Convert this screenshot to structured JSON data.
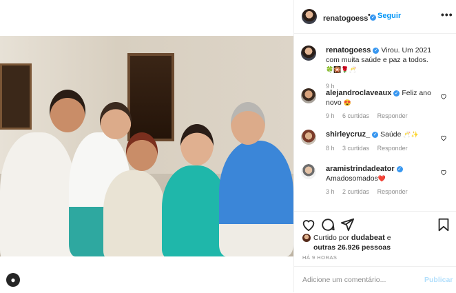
{
  "post": {
    "author": "renatogoess",
    "follow_label": "Seguir",
    "separator": "•",
    "more_label": "•••",
    "verified_mark": "✓"
  },
  "comments": [
    {
      "user": "renatogoess",
      "verified": true,
      "text": "Virou. Um 2021 com muita saúde e paz a todos.",
      "emojis": "🍀🎇🌹🥂",
      "time": "9 h",
      "likes": "",
      "reply": ""
    },
    {
      "user": "alejandroclaveaux",
      "verified": true,
      "text": "Feliz ano novo",
      "emojis": "😍",
      "time": "9 h",
      "likes": "6 curtidas",
      "reply": "Responder"
    },
    {
      "user": "shirleycruz_",
      "verified": true,
      "text": "Saúde",
      "emojis": "🥂✨",
      "time": "8 h",
      "likes": "3 curtidas",
      "reply": "Responder"
    },
    {
      "user": "aramistrindadeator",
      "verified": true,
      "text": "Amadosomados",
      "emojis": "❤️",
      "time": "3 h",
      "likes": "2 curtidas",
      "reply": "Responder"
    }
  ],
  "likes": {
    "prefix": "Curtido por",
    "user": "dudabeat",
    "and": "e",
    "others": "outras 26.926 pessoas"
  },
  "timestamp": "HÁ 9 HORAS",
  "comment_box": {
    "placeholder": "Adicione um comentário...",
    "publish_label": "Publicar"
  },
  "icons": {
    "like": "heart-icon",
    "comment": "comment-icon",
    "share": "share-icon",
    "save": "bookmark-icon",
    "more": "more-icon",
    "profile": "profile-avatar-icon"
  },
  "colors": {
    "accent": "#0095f6",
    "verified": "#3897f0",
    "muted": "#8e8e8e",
    "publish_disabled": "#b2dffc"
  }
}
